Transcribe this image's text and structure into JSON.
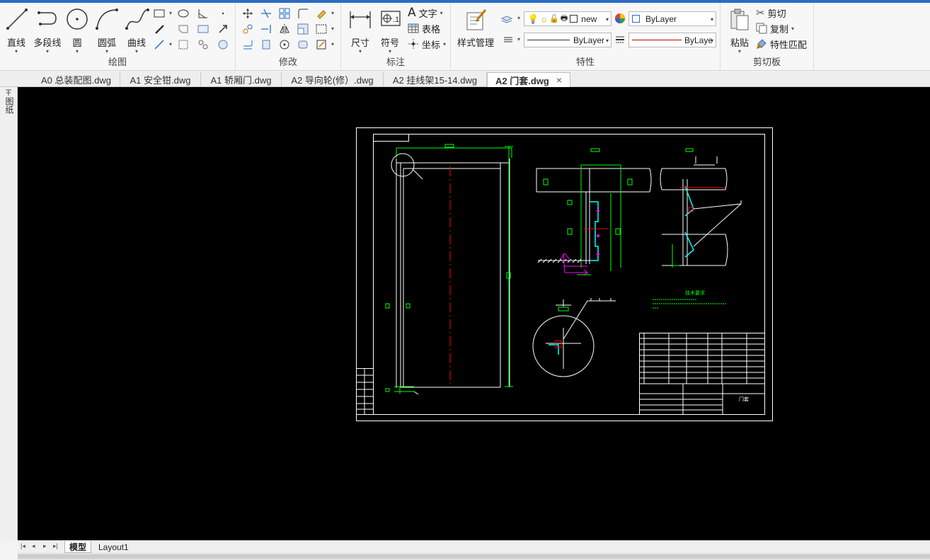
{
  "ribbon": {
    "draw": {
      "title": "绘图",
      "line": "直线",
      "polyline": "多段线",
      "circle": "圆",
      "arc": "圆弧",
      "curve": "曲线"
    },
    "modify": {
      "title": "修改"
    },
    "annotate": {
      "title": "标注",
      "dimension": "尺寸",
      "symbol": "符号",
      "text": "文字",
      "table": "表格",
      "coordinate": "坐标"
    },
    "properties": {
      "title": "特性",
      "style_manager": "样式管理",
      "layer_name": "new",
      "color_value": "ByLayer",
      "linetype_value": "ByLayer",
      "lineweight_value": "ByLaye"
    },
    "clipboard": {
      "title": "剪切板",
      "paste": "粘贴",
      "cut": "剪切",
      "copy": "复制",
      "match_properties": "特性匹配"
    }
  },
  "tabs": [
    {
      "label": "A0 总装配图.dwg",
      "active": false
    },
    {
      "label": "A1 安全钳.dwg",
      "active": false
    },
    {
      "label": "A1 轿厢门.dwg",
      "active": false
    },
    {
      "label": "A2 导向轮(修）.dwg",
      "active": false
    },
    {
      "label": "A2 挂线架15-14.dwg",
      "active": false
    },
    {
      "label": "A2 门套.dwg",
      "active": true
    }
  ],
  "tab_close": "×",
  "left_panel": {
    "label": "图纸"
  },
  "layout_tabs": [
    {
      "label": "模型",
      "active": true
    },
    {
      "label": "Layout1",
      "active": false
    }
  ],
  "drawing": {
    "title_block_name": "门套",
    "note_heading": "技术要求"
  },
  "colors": {
    "accent": "#2b6cc4",
    "canvas": "#000000",
    "cad_white": "#ffffff",
    "cad_green": "#00ff00",
    "cad_cyan": "#00ffff",
    "cad_red": "#ff0000",
    "cad_magenta": "#ff00ff"
  }
}
